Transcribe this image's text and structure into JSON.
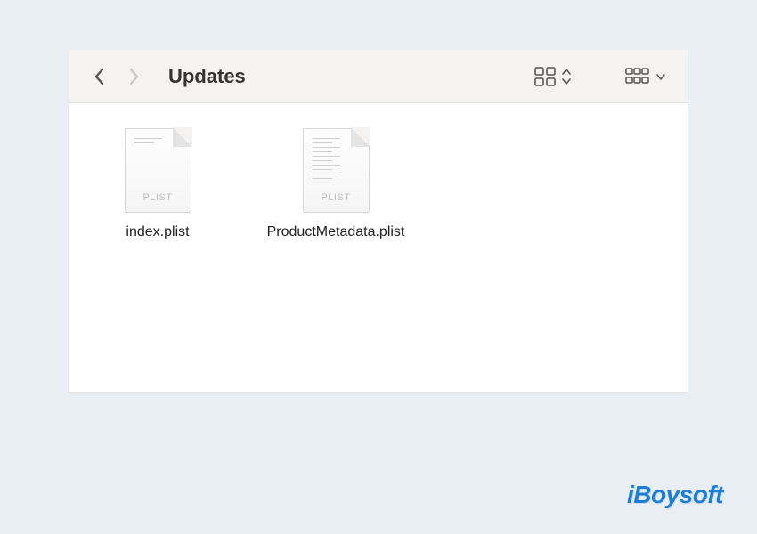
{
  "toolbar": {
    "folder_title": "Updates"
  },
  "files": [
    {
      "label": "index.plist",
      "tag": "PLIST"
    },
    {
      "label": "ProductMetadata.plist",
      "tag": "PLIST"
    }
  ],
  "watermark": "iBoysoft"
}
